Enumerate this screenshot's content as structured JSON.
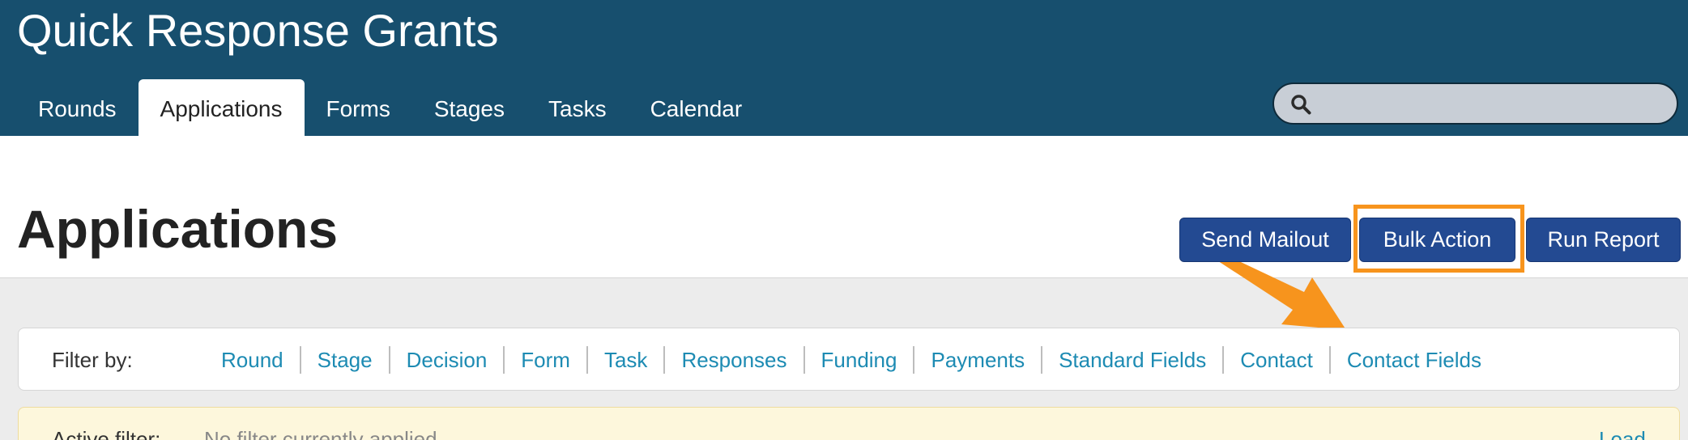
{
  "header": {
    "app_title": "Quick Response Grants",
    "tabs": [
      {
        "label": "Rounds",
        "active": false
      },
      {
        "label": "Applications",
        "active": true
      },
      {
        "label": "Forms",
        "active": false
      },
      {
        "label": "Stages",
        "active": false
      },
      {
        "label": "Tasks",
        "active": false
      },
      {
        "label": "Calendar",
        "active": false
      }
    ],
    "search": {
      "placeholder": "",
      "value": "",
      "icon": "search-icon"
    }
  },
  "page": {
    "title": "Applications",
    "actions": {
      "send_mailout": "Send Mailout",
      "bulk_action": "Bulk Action",
      "run_report": "Run Report"
    },
    "highlight_color": "#f7941d"
  },
  "filters": {
    "label": "Filter by:",
    "items": [
      "Round",
      "Stage",
      "Decision",
      "Form",
      "Task",
      "Responses",
      "Funding",
      "Payments",
      "Standard Fields",
      "Contact",
      "Contact Fields"
    ]
  },
  "active_filter": {
    "label": "Active filter:",
    "status": "No filter currently applied",
    "load_label": "Load"
  },
  "colors": {
    "header_bg": "#174f6e",
    "button_bg": "#234a92",
    "link": "#1d8bb3",
    "accent": "#f7941d"
  }
}
